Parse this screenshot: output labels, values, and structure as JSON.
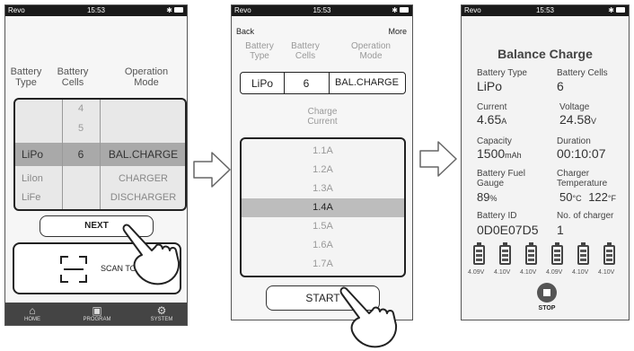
{
  "status": {
    "carrier": "Revo",
    "time": "15:53"
  },
  "screen1": {
    "headers": {
      "type": "Battery Type",
      "cells": "Battery Cells",
      "mode": "Operation Mode"
    },
    "cells_above": [
      "4",
      "5"
    ],
    "selected": {
      "type": "LiPo",
      "cells": "6",
      "mode": "BAL.CHARGE"
    },
    "types_below": [
      "LiIon",
      "LiFe"
    ],
    "modes_below": [
      "CHARGER",
      "DISCHARGER"
    ],
    "next_label": "NEXT",
    "scan_label": "SCAN TO",
    "tabs": {
      "home": "HOME",
      "program": "PROGRAM",
      "system": "SYSTEM"
    }
  },
  "screen2": {
    "back": "Back",
    "more": "More",
    "headers": {
      "type": "Battery Type",
      "cells": "Battery Cells",
      "mode": "Operation Mode"
    },
    "selected": {
      "type": "LiPo",
      "cells": "6",
      "mode": "BAL.CHARGE"
    },
    "current_label": "Charge Current",
    "currents": [
      "1.1A",
      "1.2A",
      "1.3A",
      "1.4A",
      "1.5A",
      "1.6A",
      "1.7A"
    ],
    "selected_index": 3,
    "start_label": "START"
  },
  "screen3": {
    "title": "Balance Charge",
    "battery_type_label": "Battery Type",
    "battery_type": "LiPo",
    "battery_cells_label": "Battery Cells",
    "battery_cells": "6",
    "current_label": "Current",
    "current_value": "4.65",
    "current_unit": "A",
    "voltage_label": "Voltage",
    "voltage_value": "24.58",
    "voltage_unit": "V",
    "capacity_label": "Capacity",
    "capacity_value": "1500",
    "capacity_unit": "mAh",
    "duration_label": "Duration",
    "duration_value": "00:10:07",
    "fuel_label": "Battery Fuel Gauge",
    "fuel_value": "89",
    "fuel_unit": "%",
    "temp_label": "Charger Temperature",
    "temp_c": "50",
    "temp_c_unit": "°C",
    "temp_f": "122",
    "temp_f_unit": "°F",
    "battery_id_label": "Battery ID",
    "battery_id": "0D0E07D5",
    "charger_no_label": "No. of charger",
    "charger_no": "1",
    "cell_volts": [
      "4.09V",
      "4.10V",
      "4.10V",
      "4.09V",
      "4.10V",
      "4.10V"
    ],
    "stop_label": "STOP"
  }
}
